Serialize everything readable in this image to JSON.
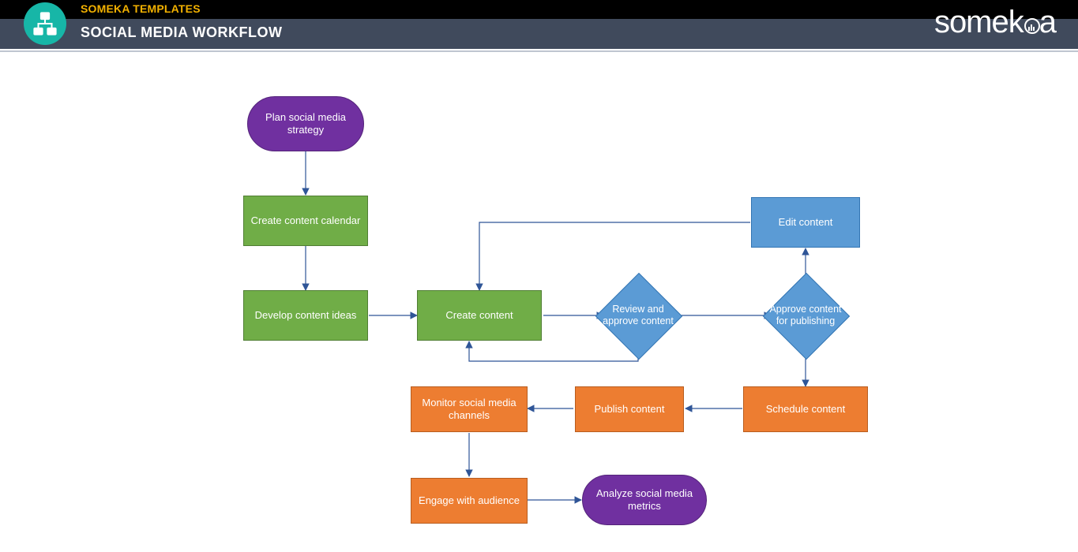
{
  "header": {
    "brand_small": "SOMEKA TEMPLATES",
    "title": "SOCIAL MEDIA WORKFLOW",
    "logo_text_left": "somek",
    "logo_text_right": "a"
  },
  "nodes": {
    "plan": "Plan social media strategy",
    "calendar": "Create content calendar",
    "ideas": "Develop content ideas",
    "create": "Create content",
    "review": "Review and approve content",
    "approve": "Approve content for publishing",
    "edit": "Edit content",
    "schedule": "Schedule content",
    "publish": "Publish content",
    "monitor": "Monitor social media channels",
    "engage": "Engage with audience",
    "analyze": "Analyze social media metrics"
  },
  "colors": {
    "green": "#70ad47",
    "orange": "#ed7d31",
    "blue": "#5b9bd5",
    "purple": "#7030a0",
    "arrow": "#2f5597"
  }
}
